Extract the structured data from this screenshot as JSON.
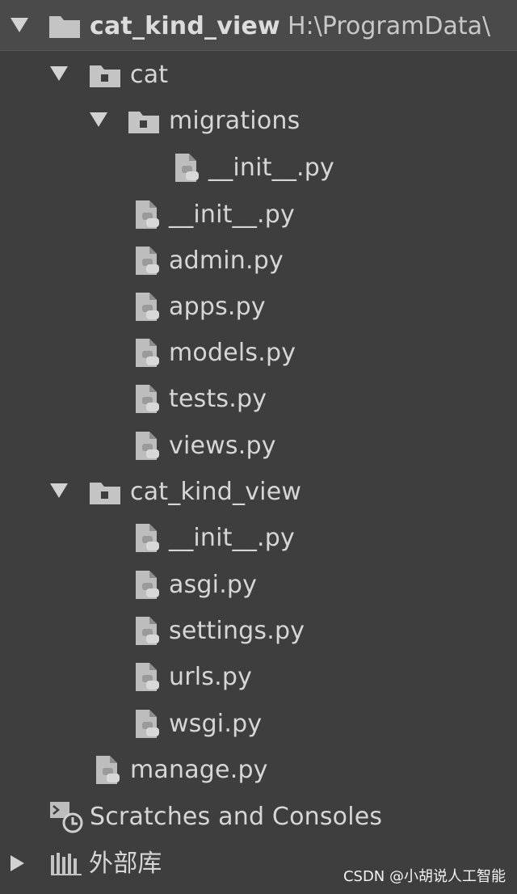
{
  "colors": {
    "background": "#3e3e3e",
    "root_highlight": "#4a4a4a",
    "text": "#d6d6d6",
    "icon": "#c4c4c4"
  },
  "tree": {
    "root": {
      "name": "cat_kind_view",
      "path": "H:\\ProgramData\\",
      "icon": "folder-icon",
      "expanded": true
    },
    "cat": {
      "name": "cat",
      "icon": "package-folder-icon",
      "expanded": true
    },
    "migrations": {
      "name": "migrations",
      "icon": "package-folder-icon",
      "expanded": true
    },
    "migrations_files": [
      {
        "name": "__init__.py",
        "icon": "python-file-icon"
      }
    ],
    "cat_files": [
      {
        "name": "__init__.py",
        "icon": "python-file-icon"
      },
      {
        "name": "admin.py",
        "icon": "python-file-icon"
      },
      {
        "name": "apps.py",
        "icon": "python-file-icon"
      },
      {
        "name": "models.py",
        "icon": "python-file-icon"
      },
      {
        "name": "tests.py",
        "icon": "python-file-icon"
      },
      {
        "name": "views.py",
        "icon": "python-file-icon"
      }
    ],
    "project_pkg": {
      "name": "cat_kind_view",
      "icon": "package-folder-icon",
      "expanded": true
    },
    "project_files": [
      {
        "name": "__init__.py",
        "icon": "python-file-icon"
      },
      {
        "name": "asgi.py",
        "icon": "python-file-icon"
      },
      {
        "name": "settings.py",
        "icon": "python-file-icon"
      },
      {
        "name": "urls.py",
        "icon": "python-file-icon"
      },
      {
        "name": "wsgi.py",
        "icon": "python-file-icon"
      }
    ],
    "manage": {
      "name": "manage.py",
      "icon": "python-file-icon"
    },
    "scratches": {
      "name": "Scratches and Consoles",
      "icon": "scratches-icon"
    },
    "external": {
      "name": "外部库",
      "icon": "library-icon",
      "expanded": false
    }
  },
  "watermark": "CSDN @小胡说人工智能"
}
